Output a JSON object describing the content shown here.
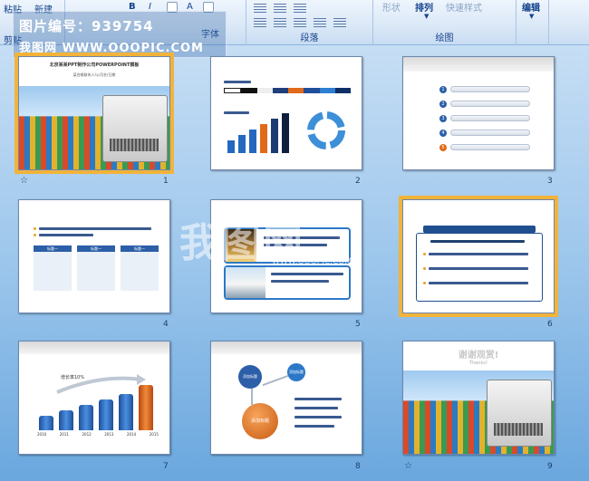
{
  "ribbon": {
    "paste_label": "粘贴",
    "new_label": "新建",
    "format_painter_label": "剪贴",
    "font_group_label": "字体",
    "paragraph_group_label": "段落",
    "drawing_group_label": "绘图",
    "shape_label": "形状",
    "arrange_label": "排列",
    "quick_style_label": "快速样式",
    "edit_label": "编辑",
    "font_bold": "B",
    "font_italic": "I",
    "font_size_aa": "A"
  },
  "watermark": {
    "line1": "图片编号：939754",
    "line2": "我图网 WWW.OOOPIC.COM",
    "center_logo": "我图网",
    "center_url": "WWW.OOOPIC.COM"
  },
  "slides": [
    {
      "number": "1",
      "title": "北京某某PPT制作公司POWERPOINT模板",
      "subtitle": "某合格联系人/公司名/日期",
      "has_star": true
    },
    {
      "number": "2",
      "has_star": false
    },
    {
      "number": "3",
      "has_star": false,
      "items": [
        "1",
        "2",
        "3",
        "4",
        "5"
      ]
    },
    {
      "number": "4",
      "has_star": false,
      "boxes": [
        "标题一",
        "标题一",
        "标题一"
      ]
    },
    {
      "number": "5",
      "has_star": false
    },
    {
      "number": "6",
      "has_star": false,
      "selected": true
    },
    {
      "number": "7",
      "has_star": false,
      "years": [
        "2010",
        "2011",
        "2012",
        "2013",
        "2014",
        "2015"
      ],
      "headline": "增长率10%"
    },
    {
      "number": "8",
      "has_star": false,
      "nodes": [
        "添加标题",
        "添加标题",
        "添加标题"
      ]
    },
    {
      "number": "9",
      "title": "谢谢观赏!",
      "subtitle": "Thanks!",
      "has_star": true
    }
  ]
}
